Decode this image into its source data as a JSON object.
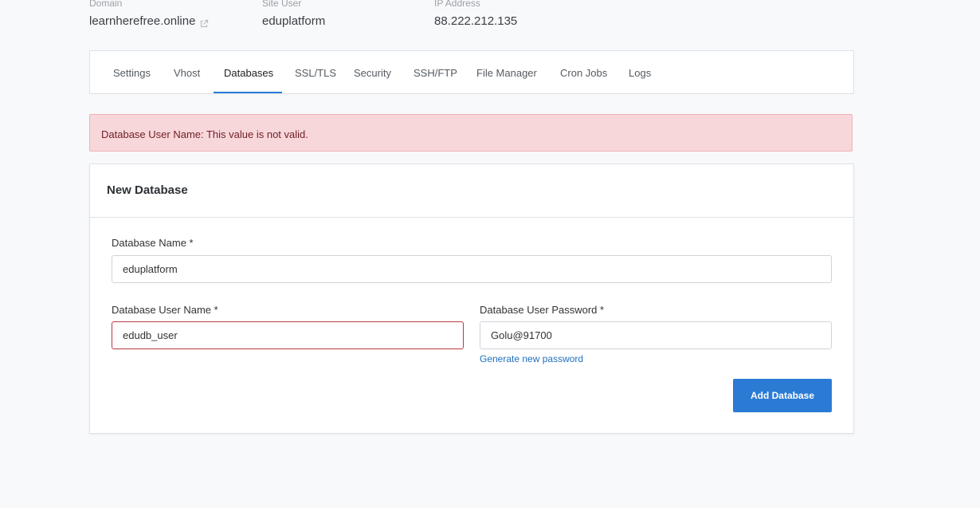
{
  "site_info": {
    "domain_label": "Domain",
    "domain_value": "learnherefree.online",
    "site_user_label": "Site User",
    "site_user_value": "eduplatform",
    "ip_label": "IP Address",
    "ip_value": "88.222.212.135"
  },
  "tabs": [
    {
      "label": "Settings",
      "active": false
    },
    {
      "label": "Vhost",
      "active": false
    },
    {
      "label": "Databases",
      "active": true
    },
    {
      "label": "SSL/TLS",
      "active": false
    },
    {
      "label": "Security",
      "active": false
    },
    {
      "label": "SSH/FTP",
      "active": false
    },
    {
      "label": "File Manager",
      "active": false
    },
    {
      "label": "Cron Jobs",
      "active": false
    },
    {
      "label": "Logs",
      "active": false
    }
  ],
  "alert": {
    "message": "Database User Name: This value is not valid."
  },
  "form": {
    "title": "New Database",
    "db_name_label": "Database Name *",
    "db_name_value": "eduplatform",
    "db_user_label": "Database User Name *",
    "db_user_value": "edudb_user",
    "db_password_label": "Database User Password *",
    "db_password_value": "Golu@91700",
    "generate_link": "Generate new password",
    "submit_label": "Add Database"
  },
  "colors": {
    "accent": "#2b7bd5",
    "alert_bg": "#f8d7da",
    "alert_text": "#6e1f25",
    "invalid_border": "#b73a45"
  },
  "icons": {
    "domain_link": "external-link-icon"
  }
}
